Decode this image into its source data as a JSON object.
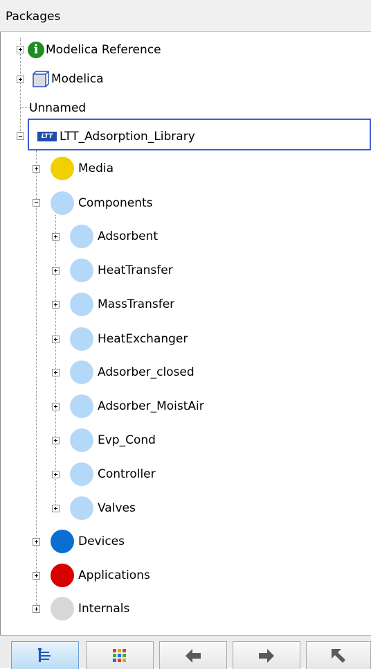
{
  "header": {
    "title": "Packages"
  },
  "tree": {
    "modelica_reference": {
      "label": "Modelica Reference"
    },
    "modelica": {
      "label": "Modelica"
    },
    "unnamed": {
      "label": "Unnamed"
    },
    "library": {
      "label": "LTT_Adsorption_Library",
      "icon_text": "LTT",
      "children": {
        "media": {
          "label": "Media",
          "color": "#f0d000"
        },
        "components": {
          "label": "Components",
          "color": "#b4d8f8",
          "children": [
            {
              "label": "Adsorbent",
              "color": "#b4d8f8"
            },
            {
              "label": "HeatTransfer",
              "color": "#b4d8f8"
            },
            {
              "label": "MassTransfer",
              "color": "#b4d8f8"
            },
            {
              "label": "HeatExchanger",
              "color": "#b4d8f8"
            },
            {
              "label": "Adsorber_closed",
              "color": "#b4d8f8"
            },
            {
              "label": "Adsorber_MoistAir",
              "color": "#b4d8f8"
            },
            {
              "label": "Evp_Cond",
              "color": "#b4d8f8"
            },
            {
              "label": "Controller",
              "color": "#b4d8f8"
            },
            {
              "label": "Valves",
              "color": "#b4d8f8"
            }
          ]
        },
        "devices": {
          "label": "Devices",
          "color": "#0a6ed2"
        },
        "applications": {
          "label": "Applications",
          "color": "#d70000"
        },
        "internals": {
          "label": "Internals",
          "color": "#d7d7d7"
        }
      }
    }
  },
  "toolbar": {
    "buttons": [
      {
        "icon": "tree-view-icon"
      },
      {
        "icon": "grid-view-icon"
      },
      {
        "icon": "arrow-left-icon"
      },
      {
        "icon": "arrow-right-icon"
      },
      {
        "icon": "arrow-up-left-icon"
      }
    ]
  }
}
